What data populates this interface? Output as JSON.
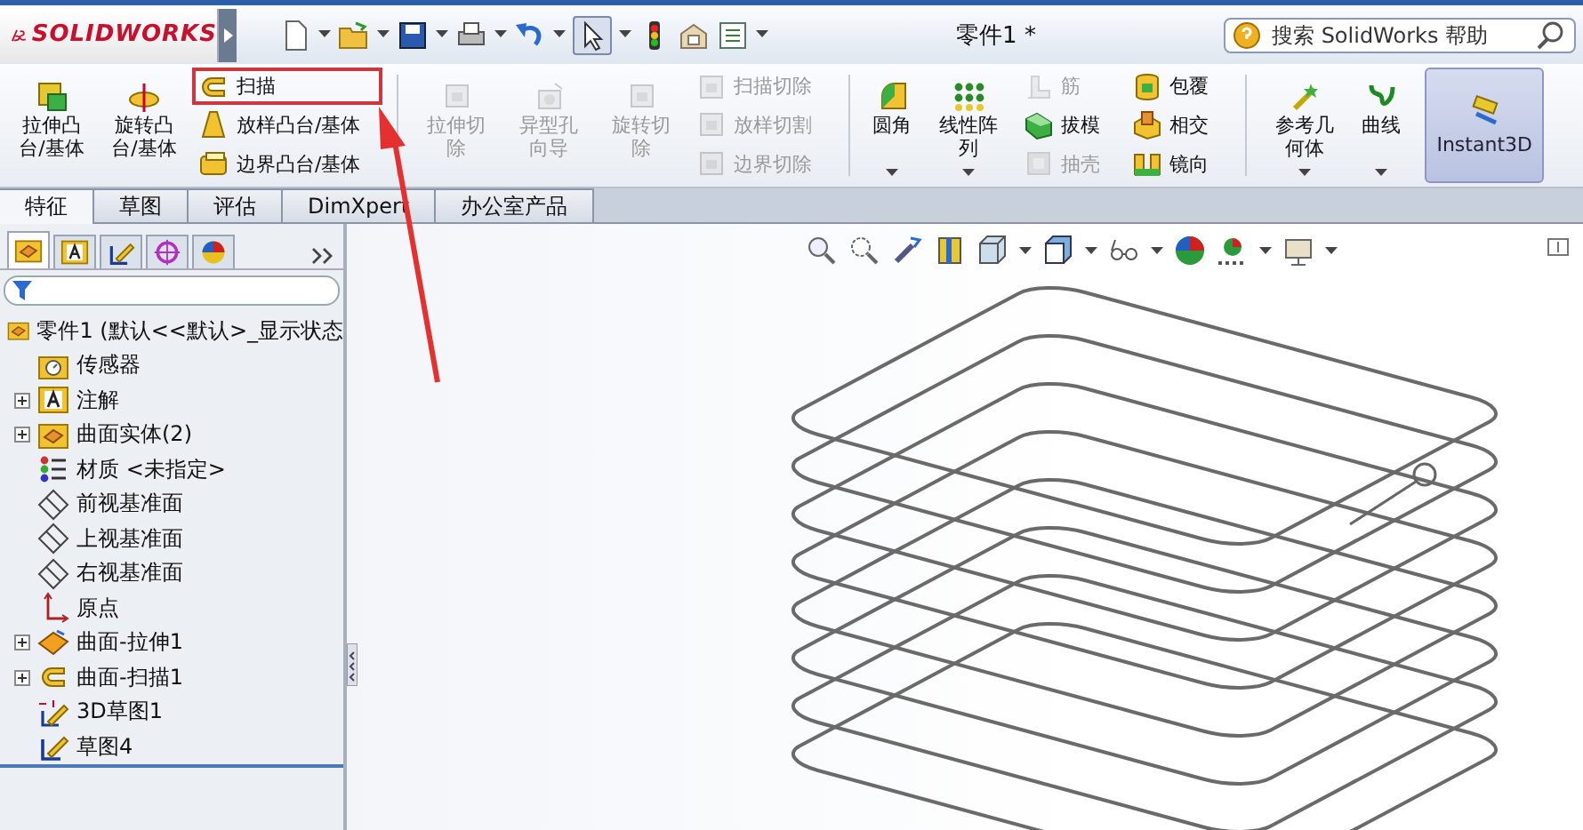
{
  "app": {
    "logo": "SOLIDWORKS"
  },
  "window": {
    "title": "零件1 *"
  },
  "search": {
    "placeholder": "搜索 SolidWorks 帮助"
  },
  "ribbon": [
    {
      "kind": "large",
      "label": "拉伸凸台/基体",
      "disabled": false,
      "dropdown": false
    },
    {
      "kind": "large",
      "label": "旋转凸台/基体",
      "disabled": false,
      "dropdown": false
    },
    {
      "kind": "stack",
      "items": [
        {
          "label": "扫描",
          "disabled": false,
          "highlighted": true
        },
        {
          "label": "放样凸台/基体",
          "disabled": false,
          "highlighted": false
        },
        {
          "label": "边界凸台/基体",
          "disabled": false,
          "highlighted": false
        }
      ]
    },
    {
      "kind": "separator"
    },
    {
      "kind": "large",
      "label": "拉伸切除",
      "disabled": true,
      "dropdown": false
    },
    {
      "kind": "large",
      "label": "异型孔向导",
      "disabled": true,
      "dropdown": false
    },
    {
      "kind": "large",
      "label": "旋转切除",
      "disabled": true,
      "dropdown": false
    },
    {
      "kind": "stack",
      "items": [
        {
          "label": "扫描切除",
          "disabled": true,
          "highlighted": false
        },
        {
          "label": "放样切割",
          "disabled": true,
          "highlighted": false
        },
        {
          "label": "边界切除",
          "disabled": true,
          "highlighted": false
        }
      ]
    },
    {
      "kind": "separator"
    },
    {
      "kind": "large",
      "label": "圆角",
      "disabled": false,
      "dropdown": true
    },
    {
      "kind": "large",
      "label": "线性阵列",
      "disabled": false,
      "dropdown": true
    },
    {
      "kind": "stack",
      "items": [
        {
          "label": "筋",
          "disabled": true,
          "highlighted": false
        },
        {
          "label": "拔模",
          "disabled": false,
          "highlighted": false
        },
        {
          "label": "抽壳",
          "disabled": true,
          "highlighted": false
        }
      ]
    },
    {
      "kind": "stack",
      "items": [
        {
          "label": "包覆",
          "disabled": false,
          "highlighted": false
        },
        {
          "label": "相交",
          "disabled": false,
          "highlighted": false
        },
        {
          "label": "镜向",
          "disabled": false,
          "highlighted": false
        }
      ]
    },
    {
      "kind": "separator"
    },
    {
      "kind": "large",
      "label": "参考几何体",
      "disabled": false,
      "dropdown": true
    },
    {
      "kind": "large",
      "label": "曲线",
      "disabled": false,
      "dropdown": true
    },
    {
      "kind": "toggle",
      "label": "Instant3D",
      "selected": true
    }
  ],
  "tabs": [
    {
      "label": "特征",
      "selected": true
    },
    {
      "label": "草图",
      "selected": false
    },
    {
      "label": "评估",
      "selected": false
    },
    {
      "label": "DimXpert",
      "selected": false
    },
    {
      "label": "办公室产品",
      "selected": false
    }
  ],
  "panel_tabs": [
    {
      "selected": true
    },
    {
      "selected": false
    },
    {
      "selected": false
    },
    {
      "selected": false
    },
    {
      "selected": false
    }
  ],
  "tree": {
    "label": "零件1  (默认<<默认>_显示状态",
    "children": [
      {
        "label": "传感器",
        "collapsed": false
      },
      {
        "label": "注解",
        "collapsed": true
      },
      {
        "label": "曲面实体(2)",
        "collapsed": true
      },
      {
        "label": "材质 <未指定>",
        "collapsed": false
      },
      {
        "label": "前视基准面",
        "collapsed": false
      },
      {
        "label": "上视基准面",
        "collapsed": false
      },
      {
        "label": "右视基准面",
        "collapsed": false
      },
      {
        "label": "原点",
        "collapsed": false
      },
      {
        "label": "曲面-拉伸1",
        "collapsed": true
      },
      {
        "label": "曲面-扫描1",
        "collapsed": true
      },
      {
        "label": "3D草图1",
        "collapsed": false
      },
      {
        "label": "草图4",
        "collapsed": false
      }
    ]
  }
}
